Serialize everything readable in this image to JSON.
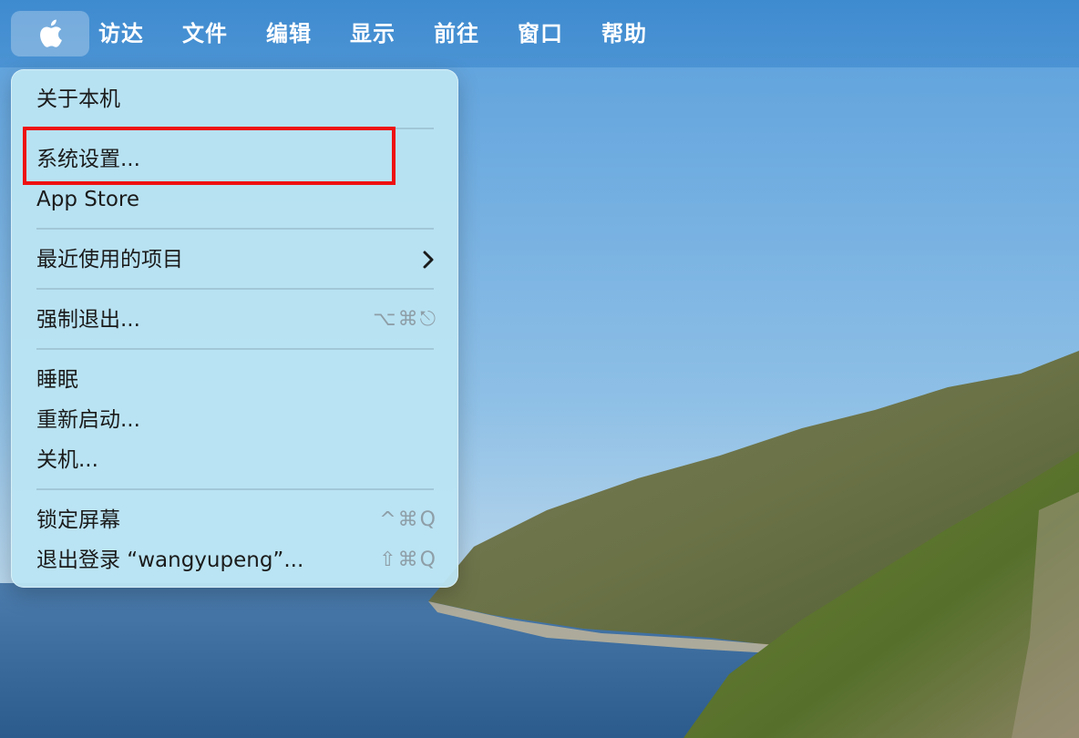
{
  "menubar": {
    "apple_icon": "apple-logo-icon",
    "items": [
      "访达",
      "文件",
      "编辑",
      "显示",
      "前往",
      "窗口",
      "帮助"
    ]
  },
  "apple_menu": {
    "about": "关于本机",
    "system_settings": "系统设置...",
    "app_store": "App Store",
    "recent_items": "最近使用的项目",
    "force_quit": "强制退出...",
    "force_quit_shortcut": "⌥⌘⎋",
    "sleep": "睡眠",
    "restart": "重新启动...",
    "shutdown": "关机...",
    "lock_screen": "锁定屏幕",
    "lock_screen_shortcut": "^⌘Q",
    "logout": "退出登录 “wangyupeng”...",
    "logout_shortcut": "⇧⌘Q"
  },
  "colors": {
    "menubar": "#4690d2",
    "menu_bg": "#bae4f3",
    "highlight": "#ee1111"
  }
}
